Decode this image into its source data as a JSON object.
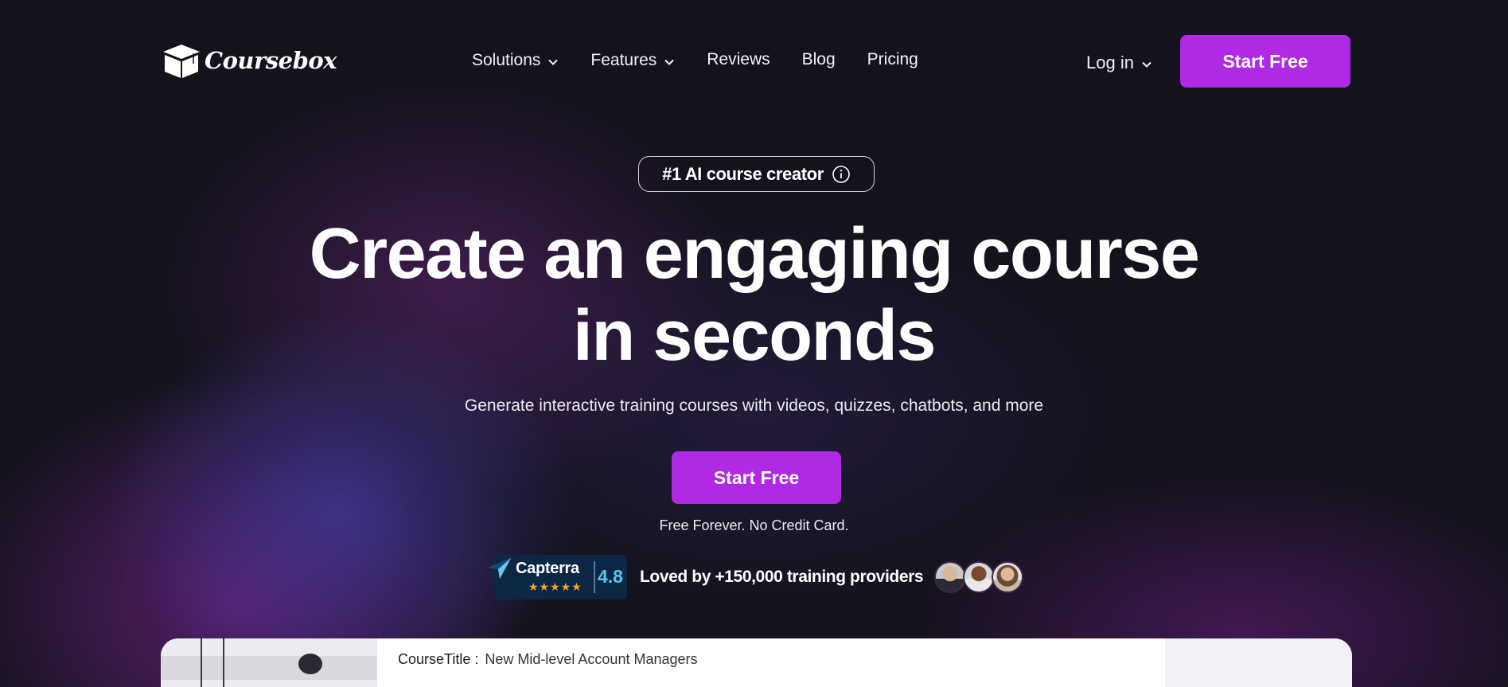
{
  "brand": {
    "name": "Coursebox",
    "logo_icon": "graduation-cap-box-icon"
  },
  "nav": {
    "items": [
      {
        "label": "Solutions",
        "has_dropdown": true
      },
      {
        "label": "Features",
        "has_dropdown": true
      },
      {
        "label": "Reviews",
        "has_dropdown": false
      },
      {
        "label": "Blog",
        "has_dropdown": false
      },
      {
        "label": "Pricing",
        "has_dropdown": false
      }
    ],
    "login_label": "Log in",
    "cta_label": "Start Free"
  },
  "hero": {
    "badge": "#1 AI course creator",
    "headline_line1": "Create an engaging course",
    "headline_line2": "in seconds",
    "subheadline": "Generate interactive training courses with videos, quizzes, chatbots, and more",
    "cta_label": "Start Free",
    "fine_print": "Free Forever. No Credit Card."
  },
  "social_proof": {
    "capterra_name": "Capterra",
    "capterra_stars": "★★★★★",
    "rating": "4.8",
    "loved_text": "Loved by +150,000 training providers"
  },
  "preview": {
    "course_title_label": "CourseTitle :",
    "course_title_value": "New Mid-level Account Managers"
  },
  "colors": {
    "accent": "#b02ae6",
    "background": "#14121c",
    "capterra_bg": "#0b2745",
    "capterra_score": "#5cc3f0",
    "star": "#f6a623"
  }
}
